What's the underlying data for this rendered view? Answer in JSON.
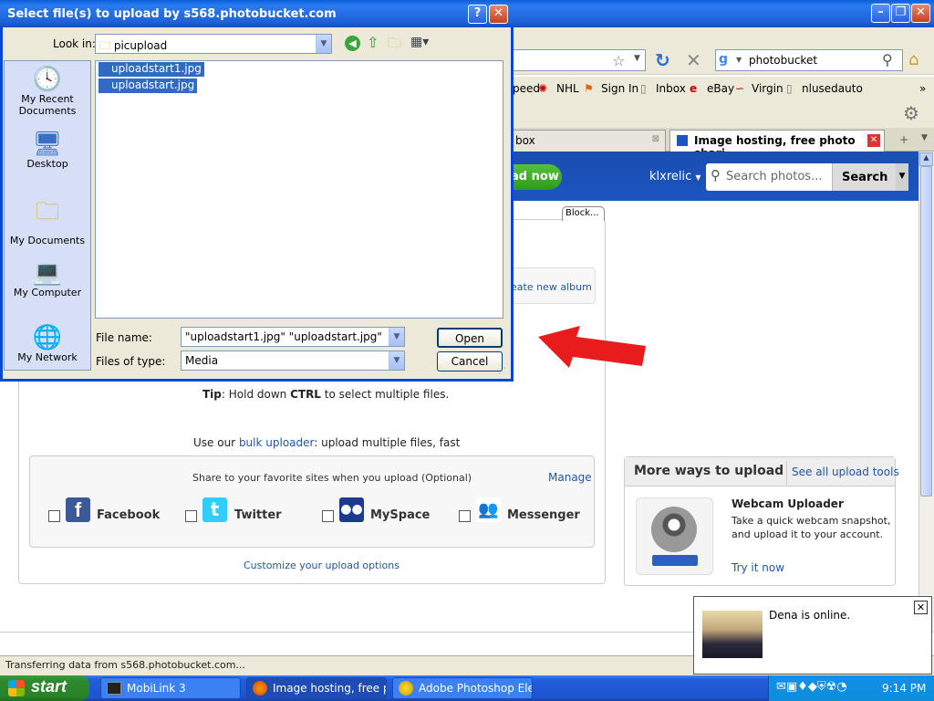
{
  "dialog": {
    "title": "Select file(s) to upload by s568.photobucket.com",
    "help_label": "?",
    "close_label": "✕",
    "look_in_label": "Look in:",
    "look_in_value": "picupload",
    "places": [
      {
        "label": "My Recent Documents"
      },
      {
        "label": "Desktop"
      },
      {
        "label": "My Documents"
      },
      {
        "label": "My Computer"
      },
      {
        "label": "My Network"
      }
    ],
    "files": [
      "uploadstart1.jpg",
      "uploadstart.jpg"
    ],
    "file_name_label": "File name:",
    "file_name_value": "\"uploadstart1.jpg\" \"uploadstart.jpg\"",
    "file_type_label": "Files of type:",
    "file_type_value": "Media",
    "open_label": "Open",
    "cancel_label": "Cancel"
  },
  "browser": {
    "search_value": "photobucket",
    "bookmarks": [
      "peed",
      "NHL",
      "Sign In",
      "Inbox",
      "eBay",
      "Virgin",
      "nlusedauto"
    ],
    "tabs": [
      "box",
      "Image hosting, free photo shari..."
    ],
    "status_text": "Transferring data from s568.photobucket.com..."
  },
  "photobucket": {
    "upload_now_label": "ad now",
    "username": "klxrelic",
    "search_placeholder": "Search photos...",
    "search_button": "Search",
    "block_label": "Block...",
    "create_album": "eate new album",
    "tip_prefix": "Tip",
    "tip_text": ": Hold down ",
    "tip_ctrl": "CTRL",
    "tip_suffix": " to select multiple files.",
    "bulk_prefix": "Use our ",
    "bulk_link": "bulk uploader",
    "bulk_suffix": ": upload multiple files, fast",
    "share_text": "Share to your favorite sites when you upload (Optional)",
    "manage_label": "Manage",
    "services": [
      "Facebook",
      "Twitter",
      "MySpace",
      "Messenger"
    ],
    "customize_label": "Customize your upload options",
    "more_ways_title": "More ways to upload",
    "see_all_label": "See all upload tools",
    "webcam_title": "Webcam Uploader",
    "webcam_desc_1": "Take a quick webcam snapshot,",
    "webcam_desc_2": "and upload it to your account.",
    "try_label": "Try it now"
  },
  "popup": {
    "text": "Dena is online."
  },
  "taskbar": {
    "start_label": "start",
    "items": [
      "MobiLink 3",
      "Image hosting, free p...",
      "Adobe Photoshop Ele..."
    ],
    "clock": "9:14 PM"
  },
  "colors": {
    "arrow": "#e81c1c",
    "accent": "#1c54c0",
    "selection": "#316ac5"
  }
}
